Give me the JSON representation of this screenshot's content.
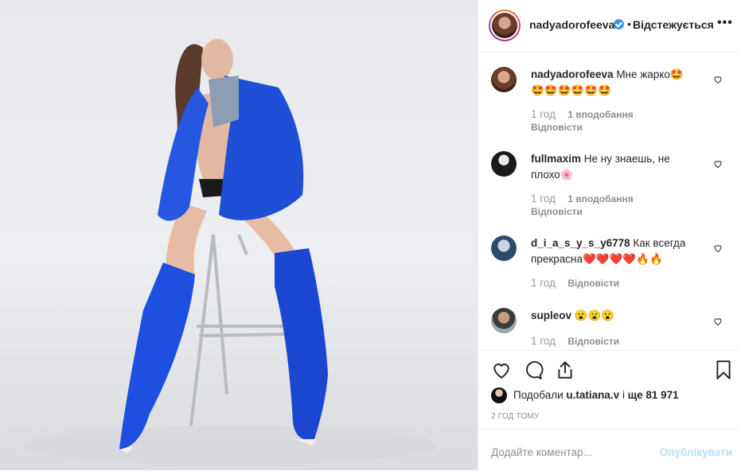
{
  "header": {
    "username": "nadyadorofeeva",
    "separator": "•",
    "follow_status": "Відстежується",
    "more": "•••"
  },
  "comments": [
    {
      "user": "nadyadorofeeva",
      "text": "Мне жарко🤩",
      "text2": "🤩🤩🤩🤩🤩🤩",
      "time": "1 год",
      "likes": "1 вподобання",
      "reply": "Відповісти"
    },
    {
      "user": "fullmaxim",
      "text": "Не ну знаешь, не",
      "text2": "плохо🌸",
      "time": "1 год",
      "likes": "1 вподобання",
      "reply": "Відповісти"
    },
    {
      "user": "d_i_a_s_y_s_y6778",
      "text": "Как всегда",
      "text2": "прекрасна❤️❤️❤️❤️🔥🔥",
      "time": "1 год",
      "reply": "Відповісти"
    },
    {
      "user": "supleov",
      "text": "😮😮😮",
      "time": "1 год",
      "reply": "Відповісти"
    }
  ],
  "likes": {
    "prefix": "Подобали ",
    "user": "u.tatiana.v",
    "mid": " і ",
    "count": "ще 81 971"
  },
  "posted_ago": "2 ГОД ТОМУ",
  "add_comment": {
    "placeholder": "Додайте коментар...",
    "publish": "Опублікувати"
  },
  "colors": {
    "accent_blue": "#3897f0",
    "publish_disabled": "#b2dffc",
    "jacket_blue": "#1e4fd6"
  }
}
